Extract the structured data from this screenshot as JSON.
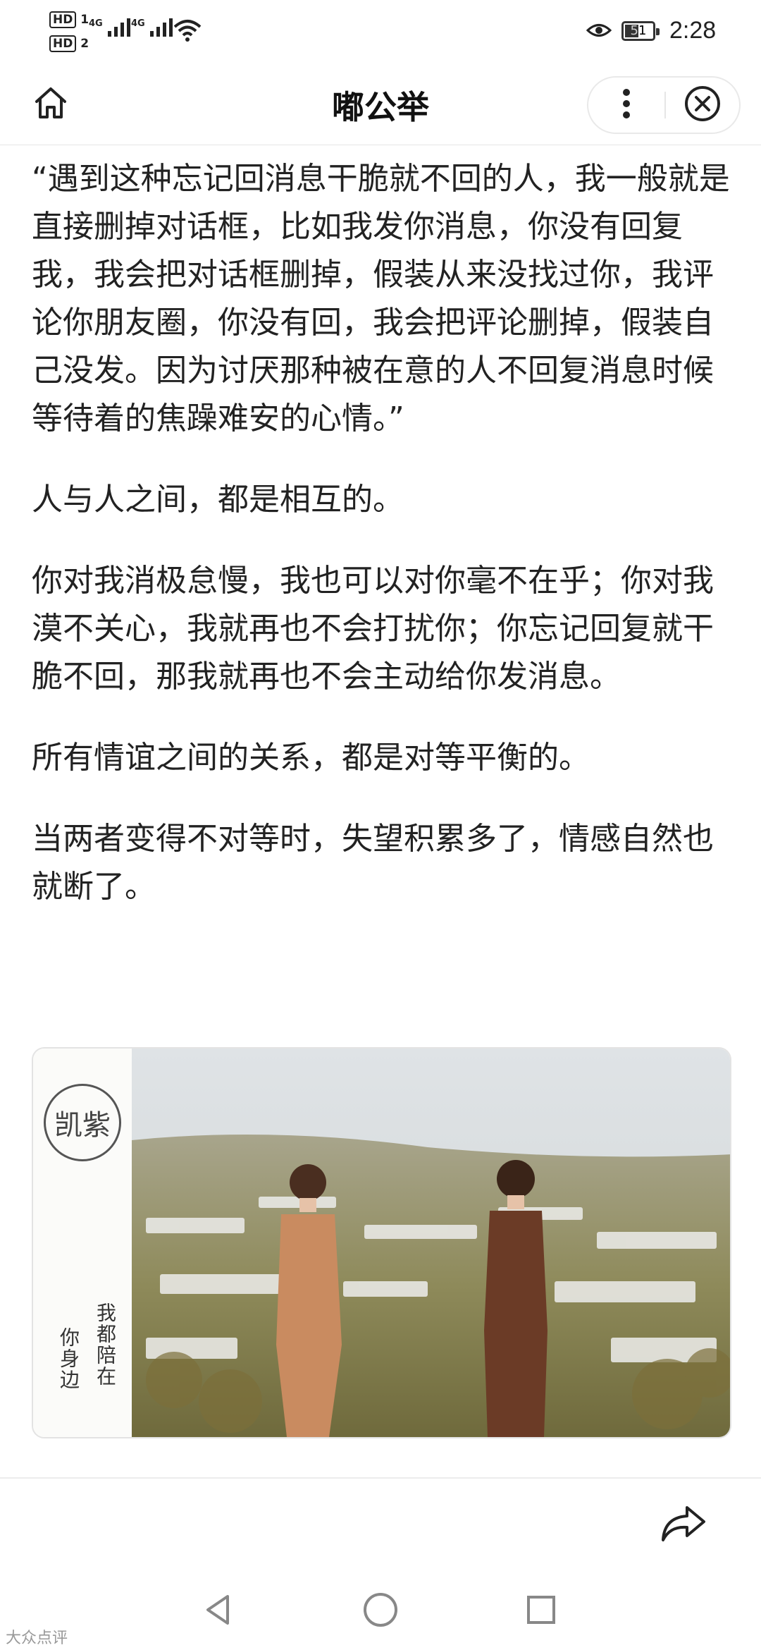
{
  "status_bar": {
    "sim1": "HD",
    "sim1_index": "1",
    "sim2": "HD",
    "sim2_index": "2",
    "network1": "4G",
    "network2": "4G",
    "battery": "51",
    "battery_level": 0.51,
    "time": "2:28"
  },
  "header": {
    "title": "嘟公举",
    "home_icon": "home-icon",
    "more_icon": "more-vertical-icon",
    "close_icon": "close-circle-icon"
  },
  "article": {
    "paragraphs": [
      "“遇到这种忘记回消息干脆就不回的人，我一般就是直接删掉对话框，比如我发你消息，你没有回复我，我会把对话框删掉，假装从来没找过你，我评论你朋友圈，你没有回，我会把评论删掉，假装自己没发。因为讨厌那种被在意的人不回复消息时候等待着的焦躁难安的心情。”",
      "人与人之间，都是相互的。",
      "你对我消极怠慢，我也可以对你毫不在乎；你对我漠不关心，我就再也不会打扰你；你忘记回复就干脆不回，那我就再也不会主动给你发消息。",
      "所有情谊之间的关系，都是对等平衡的。",
      "当两者变得不对等时，失望积累多了，情感自然也就断了。"
    ]
  },
  "image": {
    "logo_text": "凯紫",
    "caption_line1": "我都陪在",
    "caption_line2": "你身边"
  },
  "actions": {
    "share_icon": "share-icon"
  },
  "navbar": {
    "back_icon": "back-triangle-icon",
    "home_icon": "home-circle-icon",
    "recents_icon": "recents-square-icon"
  },
  "watermark": "大众点评"
}
